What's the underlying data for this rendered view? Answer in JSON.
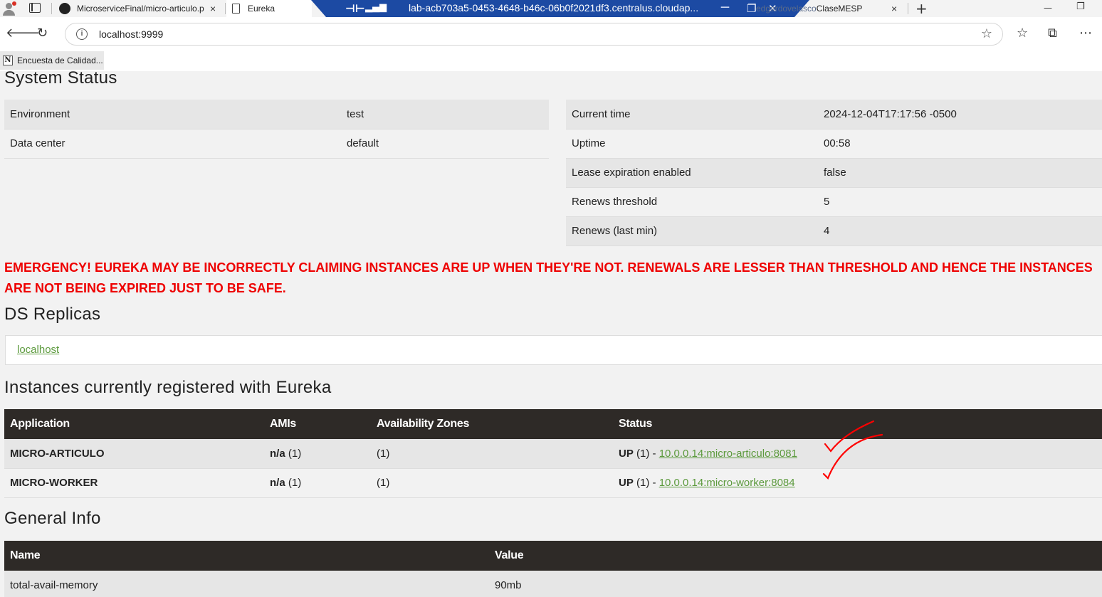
{
  "browser": {
    "tabs": [
      {
        "title": "MicroserviceFinal/micro-articulo.p",
        "close": "×"
      },
      {
        "title": "Eureka"
      },
      {
        "title": "ClaseMESP",
        "close": "×"
      }
    ],
    "new_tab": "+",
    "remote_session_title": "lab-acb703a5-0453-4648-b46c-06b0f2021df3.centralus.cloudap...",
    "remote_overlay_text": "edgardovelasco",
    "window_controls": {
      "minimize": "—",
      "restore": "❐"
    },
    "address_url": "localhost:9999",
    "favorite": {
      "icon_letter": "N",
      "label": "Encuesta de Calidad..."
    }
  },
  "system_status": {
    "title": "System Status",
    "left_rows": [
      {
        "label": "Environment",
        "value": "test"
      },
      {
        "label": "Data center",
        "value": "default"
      }
    ],
    "right_rows": [
      {
        "label": "Current time",
        "value": "2024-12-04T17:17:56 -0500"
      },
      {
        "label": "Uptime",
        "value": "00:58"
      },
      {
        "label": "Lease expiration enabled",
        "value": "false"
      },
      {
        "label": "Renews threshold",
        "value": "5"
      },
      {
        "label": "Renews (last min)",
        "value": "4"
      }
    ]
  },
  "emergency_message": "EMERGENCY! EUREKA MAY BE INCORRECTLY CLAIMING INSTANCES ARE UP WHEN THEY'RE NOT. RENEWALS ARE LESSER THAN THRESHOLD AND HENCE THE INSTANCES ARE NOT BEING EXPIRED JUST TO BE SAFE.",
  "ds_replicas": {
    "title": "DS Replicas",
    "replica_link": "localhost"
  },
  "instances": {
    "title": "Instances currently registered with Eureka",
    "headers": [
      "Application",
      "AMIs",
      "Availability Zones",
      "Status"
    ],
    "rows": [
      {
        "application": "MICRO-ARTICULO",
        "amis_value": "n/a",
        "amis_count": "(1)",
        "zones": "(1)",
        "status": "UP",
        "status_count": "(1) -",
        "instance_link": "10.0.0.14:micro-articulo:8081"
      },
      {
        "application": "MICRO-WORKER",
        "amis_value": "n/a",
        "amis_count": "(1)",
        "zones": "(1)",
        "status": "UP",
        "status_count": "(1) -",
        "instance_link": "10.0.0.14:micro-worker:8084"
      }
    ]
  },
  "general_info": {
    "title": "General Info",
    "headers": [
      "Name",
      "Value"
    ],
    "rows": [
      {
        "name": "total-avail-memory",
        "value": "90mb"
      }
    ]
  },
  "annotation_color": "#ff0000",
  "link_color": "#5c9a3d"
}
